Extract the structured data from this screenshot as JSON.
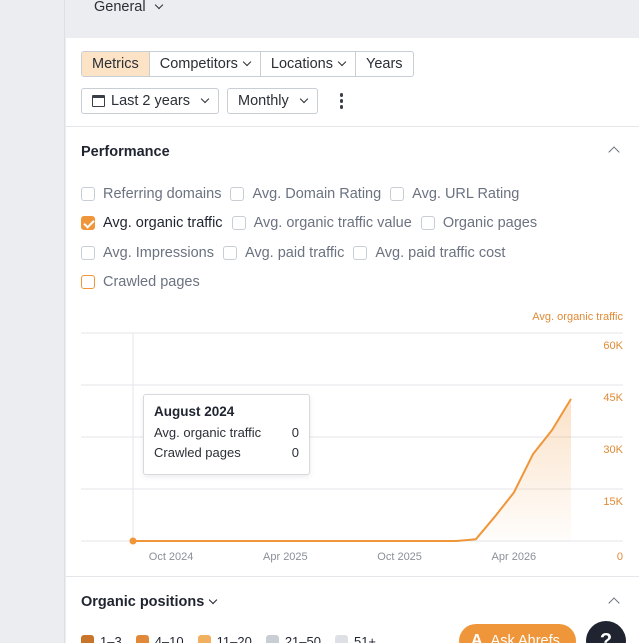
{
  "top": {
    "general_label": "General"
  },
  "tabs": [
    {
      "label": "Metrics",
      "active": true
    },
    {
      "label": "Competitors",
      "has_dropdown": true
    },
    {
      "label": "Locations",
      "has_dropdown": true
    },
    {
      "label": "Years"
    }
  ],
  "controls": {
    "date_range": "Last 2 years",
    "interval": "Monthly"
  },
  "performance": {
    "title": "Performance",
    "rows": [
      [
        {
          "label": "Referring domains",
          "checked": false
        },
        {
          "label": "Avg. Domain Rating",
          "checked": false
        },
        {
          "label": "Avg. URL Rating",
          "checked": false
        }
      ],
      [
        {
          "label": "Avg. organic traffic",
          "checked": true
        },
        {
          "label": "Avg. organic traffic value",
          "checked": false
        },
        {
          "label": "Organic pages",
          "checked": false
        }
      ],
      [
        {
          "label": "Avg. Impressions",
          "checked": false
        },
        {
          "label": "Avg. paid traffic",
          "checked": false
        },
        {
          "label": "Avg. paid traffic cost",
          "checked": false
        }
      ],
      [
        {
          "label": "Crawled pages",
          "checked": false,
          "outlined": true
        }
      ]
    ]
  },
  "chart_data": {
    "type": "area",
    "series": [
      {
        "name": "Avg. organic traffic",
        "color": "#f0963a",
        "x": [
          "2024-08",
          "2024-09",
          "2024-10",
          "2024-11",
          "2024-12",
          "2025-01",
          "2025-02",
          "2025-03",
          "2025-04",
          "2025-05",
          "2025-06",
          "2025-07",
          "2025-08",
          "2025-09",
          "2025-10",
          "2025-11",
          "2025-12",
          "2026-01",
          "2026-02",
          "2026-03",
          "2026-04",
          "2026-05",
          "2026-06",
          "2026-07"
        ],
        "values": [
          0,
          0,
          0,
          0,
          0,
          0,
          0,
          0,
          0,
          0,
          0,
          0,
          0,
          0,
          0,
          0,
          0,
          0,
          500,
          7000,
          14000,
          25000,
          32000,
          41000
        ]
      }
    ],
    "x_tick_labels": [
      "Oct 2024",
      "Apr 2025",
      "Oct 2025",
      "Apr 2026"
    ],
    "y_tick_labels": [
      "0",
      "15K",
      "30K",
      "45K",
      "60K"
    ],
    "y_axis_title": "Avg. organic traffic",
    "ylim": [
      0,
      60000
    ],
    "grid": true
  },
  "tooltip": {
    "title": "August 2024",
    "rows": [
      {
        "label": "Avg. organic traffic",
        "value": "0"
      },
      {
        "label": "Crawled pages",
        "value": "0"
      }
    ]
  },
  "organic_positions": {
    "title": "Organic positions",
    "legend": [
      {
        "label": "1–3",
        "color": "#c8742a"
      },
      {
        "label": "4–10",
        "color": "#e0893a"
      },
      {
        "label": "11–20",
        "color": "#f0b060"
      },
      {
        "label": "21–50",
        "color": "#c9cdd4"
      },
      {
        "label": "51+",
        "color": "#dde0e4"
      }
    ]
  },
  "assistant": {
    "ask_label": "Ask Ahrefs",
    "help_label": "?"
  }
}
